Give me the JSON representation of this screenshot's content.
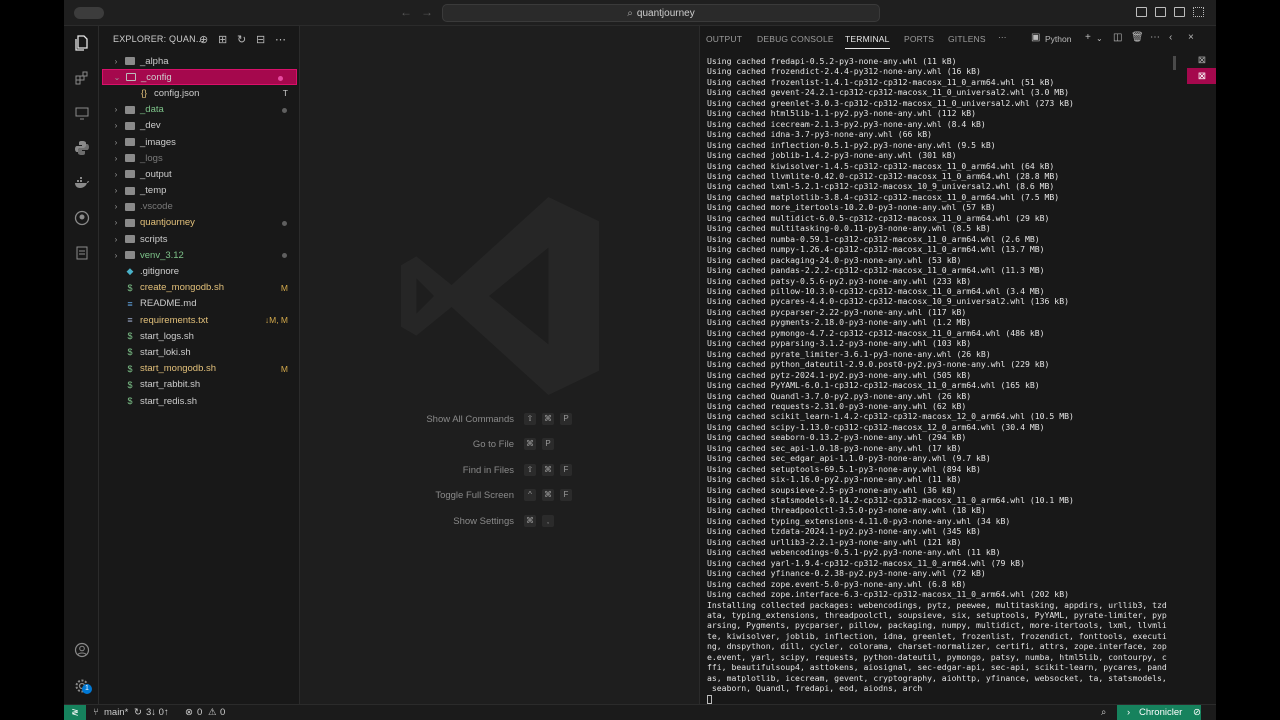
{
  "titlebar": {
    "search_text": "quantjourney",
    "nav_back": "←",
    "nav_forward": "→"
  },
  "activity_bar": {
    "items": [
      "explorer-icon",
      "extensions-icon",
      "remote-explorer-icon",
      "python-icon",
      "docker-icon",
      "github-icon",
      "database-icon"
    ],
    "bottom": [
      "account-icon",
      "manage-gear-icon"
    ],
    "badge": "1"
  },
  "sidebar": {
    "title": "EXPLORER: QUAN...",
    "tree": [
      {
        "label": "_alpha",
        "type": "folder",
        "expanded": false,
        "status": "",
        "dot": false,
        "dim": false,
        "color": ""
      },
      {
        "label": "_config",
        "type": "folder",
        "expanded": true,
        "status": "",
        "dot": true,
        "selected": true,
        "color": ""
      },
      {
        "label": "config.json",
        "type": "json",
        "indent": 1,
        "status": "T",
        "dot": false,
        "color": ""
      },
      {
        "label": "_data",
        "type": "folder",
        "status": "",
        "dot": true,
        "color": "green"
      },
      {
        "label": "_dev",
        "type": "folder",
        "status": "",
        "dot": false,
        "color": ""
      },
      {
        "label": "_images",
        "type": "folder",
        "status": "",
        "dot": false,
        "color": ""
      },
      {
        "label": "_logs",
        "type": "folder",
        "status": "",
        "dot": false,
        "color": "dim"
      },
      {
        "label": "_output",
        "type": "folder",
        "status": "",
        "dot": false,
        "color": ""
      },
      {
        "label": "_temp",
        "type": "folder",
        "status": "",
        "dot": false,
        "color": ""
      },
      {
        "label": ".vscode",
        "type": "folder",
        "status": "",
        "dot": false,
        "color": "dim"
      },
      {
        "label": "quantjourney",
        "type": "folder",
        "status": "",
        "dot": true,
        "color": "yellow"
      },
      {
        "label": "scripts",
        "type": "folder",
        "status": "",
        "dot": false,
        "color": ""
      },
      {
        "label": "venv_3.12",
        "type": "folder",
        "status": "",
        "dot": true,
        "color": "green"
      },
      {
        "label": ".gitignore",
        "type": "git",
        "status": "",
        "dot": false,
        "color": ""
      },
      {
        "label": "create_mongodb.sh",
        "type": "sh",
        "status": "M",
        "dot": false,
        "color": "yellow"
      },
      {
        "label": "README.md",
        "type": "md",
        "status": "",
        "dot": false,
        "color": ""
      },
      {
        "label": "requirements.txt",
        "type": "txt",
        "status": "↓M, M",
        "dot": false,
        "color": "yellow"
      },
      {
        "label": "start_logs.sh",
        "type": "sh",
        "status": "",
        "dot": false,
        "color": ""
      },
      {
        "label": "start_loki.sh",
        "type": "sh",
        "status": "",
        "dot": false,
        "color": ""
      },
      {
        "label": "start_mongodb.sh",
        "type": "sh",
        "status": "M",
        "dot": false,
        "color": "yellow"
      },
      {
        "label": "start_rabbit.sh",
        "type": "sh",
        "status": "",
        "dot": false,
        "color": ""
      },
      {
        "label": "start_redis.sh",
        "type": "sh",
        "status": "",
        "dot": false,
        "color": ""
      }
    ]
  },
  "editor": {
    "hints": [
      {
        "label": "Show All Commands",
        "keys": [
          "⇧",
          "⌘",
          "P"
        ]
      },
      {
        "label": "Go to File",
        "keys": [
          "⌘",
          "P"
        ]
      },
      {
        "label": "Find in Files",
        "keys": [
          "⇧",
          "⌘",
          "F"
        ]
      },
      {
        "label": "Toggle Full Screen",
        "keys": [
          "^",
          "⌘",
          "F"
        ]
      },
      {
        "label": "Show Settings",
        "keys": [
          "⌘",
          ","
        ]
      }
    ]
  },
  "panel": {
    "tabs": [
      "OUTPUT",
      "DEBUG CONSOLE",
      "TERMINAL",
      "PORTS",
      "GITLENS"
    ],
    "active_tab": "TERMINAL",
    "terminal_name": "Python",
    "terminal_lines": [
      "Using cached fredapi-0.5.2-py3-none-any.whl (11 kB)",
      "Using cached frozendict-2.4.4-py312-none-any.whl (16 kB)",
      "Using cached frozenlist-1.4.1-cp312-cp312-macosx_11_0_arm64.whl (51 kB)",
      "Using cached gevent-24.2.1-cp312-cp312-macosx_11_0_universal2.whl (3.0 MB)",
      "Using cached greenlet-3.0.3-cp312-cp312-macosx_11_0_universal2.whl (273 kB)",
      "Using cached html5lib-1.1-py2.py3-none-any.whl (112 kB)",
      "Using cached icecream-2.1.3-py2.py3-none-any.whl (8.4 kB)",
      "Using cached idna-3.7-py3-none-any.whl (66 kB)",
      "Using cached inflection-0.5.1-py2.py3-none-any.whl (9.5 kB)",
      "Using cached joblib-1.4.2-py3-none-any.whl (301 kB)",
      "Using cached kiwisolver-1.4.5-cp312-cp312-macosx_11_0_arm64.whl (64 kB)",
      "Using cached llvmlite-0.42.0-cp312-cp312-macosx_11_0_arm64.whl (28.8 MB)",
      "Using cached lxml-5.2.1-cp312-cp312-macosx_10_9_universal2.whl (8.6 MB)",
      "Using cached matplotlib-3.8.4-cp312-cp312-macosx_11_0_arm64.whl (7.5 MB)",
      "Using cached more_itertools-10.2.0-py3-none-any.whl (57 kB)",
      "Using cached multidict-6.0.5-cp312-cp312-macosx_11_0_arm64.whl (29 kB)",
      "Using cached multitasking-0.0.11-py3-none-any.whl (8.5 kB)",
      "Using cached numba-0.59.1-cp312-cp312-macosx_11_0_arm64.whl (2.6 MB)",
      "Using cached numpy-1.26.4-cp312-cp312-macosx_11_0_arm64.whl (13.7 MB)",
      "Using cached packaging-24.0-py3-none-any.whl (53 kB)",
      "Using cached pandas-2.2.2-cp312-cp312-macosx_11_0_arm64.whl (11.3 MB)",
      "Using cached patsy-0.5.6-py2.py3-none-any.whl (233 kB)",
      "Using cached pillow-10.3.0-cp312-cp312-macosx_11_0_arm64.whl (3.4 MB)",
      "Using cached pycares-4.4.0-cp312-cp312-macosx_10_9_universal2.whl (136 kB)",
      "Using cached pycparser-2.22-py3-none-any.whl (117 kB)",
      "Using cached pygments-2.18.0-py3-none-any.whl (1.2 MB)",
      "Using cached pymongo-4.7.2-cp312-cp312-macosx_11_0_arm64.whl (486 kB)",
      "Using cached pyparsing-3.1.2-py3-none-any.whl (103 kB)",
      "Using cached pyrate_limiter-3.6.1-py3-none-any.whl (26 kB)",
      "Using cached python_dateutil-2.9.0.post0-py2.py3-none-any.whl (229 kB)",
      "Using cached pytz-2024.1-py2.py3-none-any.whl (505 kB)",
      "Using cached PyYAML-6.0.1-cp312-cp312-macosx_11_0_arm64.whl (165 kB)",
      "Using cached Quandl-3.7.0-py2.py3-none-any.whl (26 kB)",
      "Using cached requests-2.31.0-py3-none-any.whl (62 kB)",
      "Using cached scikit_learn-1.4.2-cp312-cp312-macosx_12_0_arm64.whl (10.5 MB)",
      "Using cached scipy-1.13.0-cp312-cp312-macosx_12_0_arm64.whl (30.4 MB)",
      "Using cached seaborn-0.13.2-py3-none-any.whl (294 kB)",
      "Using cached sec_api-1.0.18-py3-none-any.whl (17 kB)",
      "Using cached sec_edgar_api-1.1.0-py3-none-any.whl (9.7 kB)",
      "Using cached setuptools-69.5.1-py3-none-any.whl (894 kB)",
      "Using cached six-1.16.0-py2.py3-none-any.whl (11 kB)",
      "Using cached soupsieve-2.5-py3-none-any.whl (36 kB)",
      "Using cached statsmodels-0.14.2-cp312-cp312-macosx_11_0_arm64.whl (10.1 MB)",
      "Using cached threadpoolctl-3.5.0-py3-none-any.whl (18 kB)",
      "Using cached typing_extensions-4.11.0-py3-none-any.whl (34 kB)",
      "Using cached tzdata-2024.1-py2.py3-none-any.whl (345 kB)",
      "Using cached urllib3-2.2.1-py3-none-any.whl (121 kB)",
      "Using cached webencodings-0.5.1-py2.py3-none-any.whl (11 kB)",
      "Using cached yarl-1.9.4-cp312-cp312-macosx_11_0_arm64.whl (79 kB)",
      "Using cached yfinance-0.2.38-py2.py3-none-any.whl (72 kB)",
      "Using cached zope.event-5.0-py3-none-any.whl (6.8 kB)",
      "Using cached zope.interface-6.3-cp312-cp312-macosx_11_0_arm64.whl (202 kB)",
      "Installing collected packages: webencodings, pytz, peewee, multitasking, appdirs, urllib3, tzd",
      "ata, typing_extensions, threadpoolctl, soupsieve, six, setuptools, PyYAML, pyrate-limiter, pyp",
      "arsing, Pygments, pycparser, pillow, packaging, numpy, multidict, more-itertools, lxml, llvmli",
      "te, kiwisolver, joblib, inflection, idna, greenlet, frozenlist, frozendict, fonttools, executi",
      "ng, dnspython, dill, cycler, colorama, charset-normalizer, certifi, attrs, zope.interface, zop",
      "e.event, yarl, scipy, requests, python-dateutil, pymongo, patsy, numba, html5lib, contourpy, c",
      "ffi, beautifulsoup4, asttokens, aiosignal, sec-edgar-api, sec-api, scikit-learn, pycares, pand",
      "as, matplotlib, icecream, gevent, cryptography, aiohttp, yfinance, websocket, ta, statsmodels,",
      " seaborn, Quandl, fredapi, eod, aiodns, arch"
    ]
  },
  "statusbar": {
    "branch": "main*",
    "sync": "3↓ 0↑",
    "problems": "0",
    "warnings": "0",
    "chronicler": "Chronicler"
  }
}
